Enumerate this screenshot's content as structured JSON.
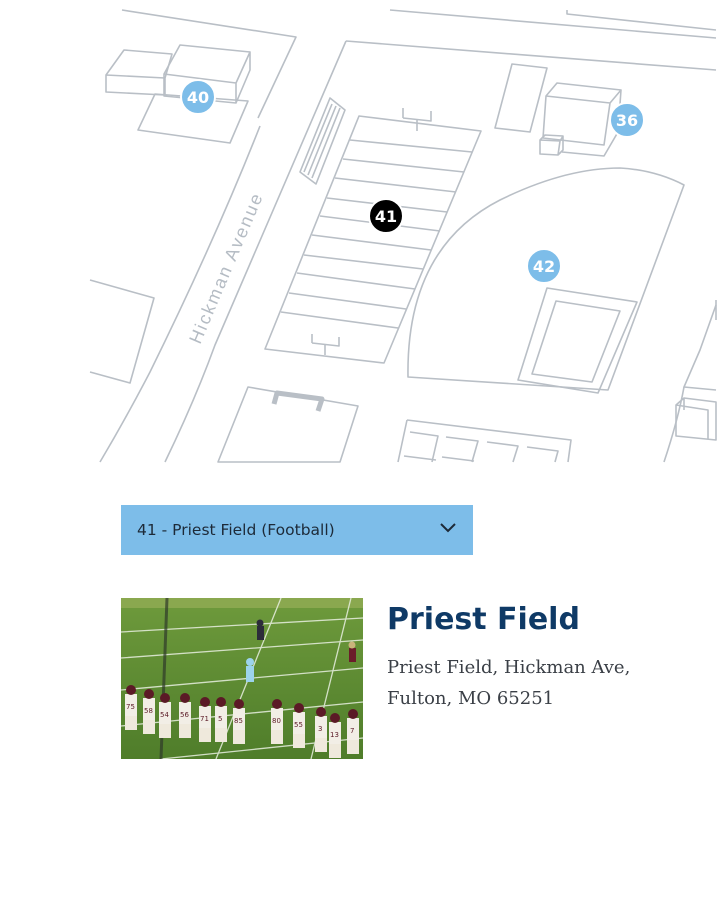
{
  "map": {
    "street_name": "Hickman Avenue",
    "markers": [
      {
        "id": "40",
        "label": "40",
        "color": "#7dbde9"
      },
      {
        "id": "36",
        "label": "36",
        "color": "#7dbde9"
      },
      {
        "id": "41",
        "label": "41",
        "color": "#000000"
      },
      {
        "id": "42",
        "label": "42",
        "color": "#7dbde9"
      }
    ]
  },
  "selector": {
    "selected_label": "41 - Priest Field (Football)",
    "icon": "chevron-down-icon",
    "background": "#7dbde9"
  },
  "location": {
    "title": "Priest Field",
    "address_line1": "Priest Field, Hickman Ave,",
    "address_line2": "Fulton, MO 65251",
    "title_color": "#0f3a66"
  },
  "photo": {
    "jersey_numbers": [
      "75",
      "58",
      "54",
      "56",
      "71",
      "5",
      "85",
      "80",
      "55",
      "3",
      "13",
      "7"
    ]
  }
}
